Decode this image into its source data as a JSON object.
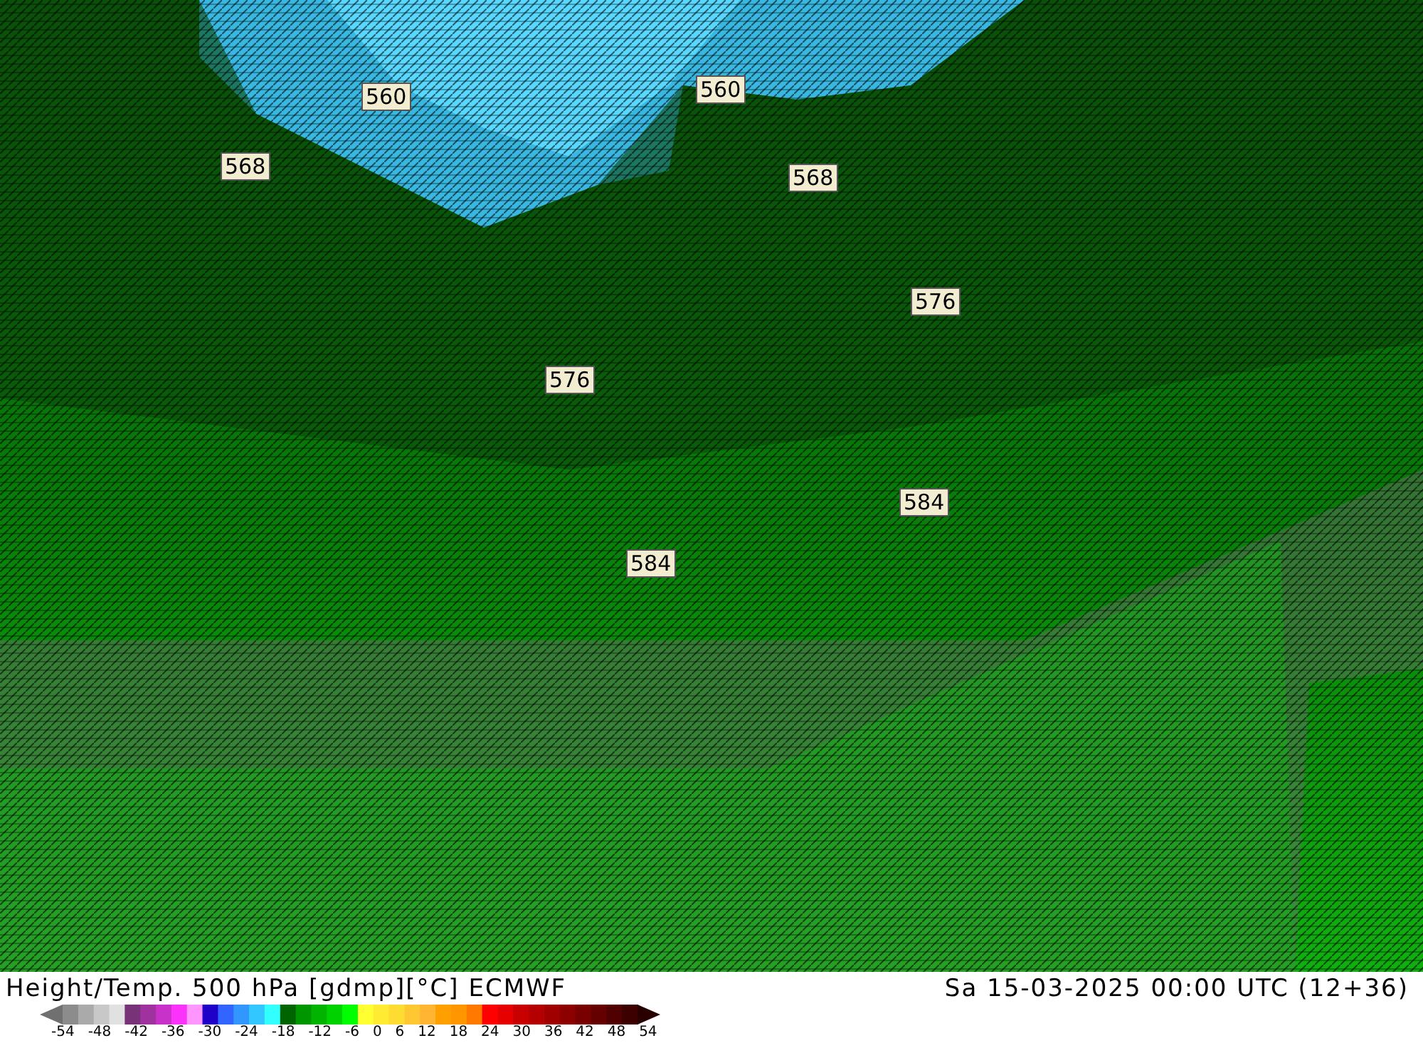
{
  "map": {
    "contour_labels": [
      "560",
      "560",
      "568",
      "568",
      "576",
      "576",
      "584",
      "584"
    ]
  },
  "footer": {
    "title": "Height/Temp. 500 hPa [gdmp][°C] ECMWF",
    "datetime": "Sa 15-03-2025 00:00 UTC (12+36)",
    "legend": {
      "ticks": [
        "-54",
        "-48",
        "-42",
        "-36",
        "-30",
        "-24",
        "-18",
        "-12",
        "-6",
        "0",
        "6",
        "12",
        "18",
        "24",
        "30",
        "36",
        "42",
        "48",
        "54"
      ]
    }
  }
}
